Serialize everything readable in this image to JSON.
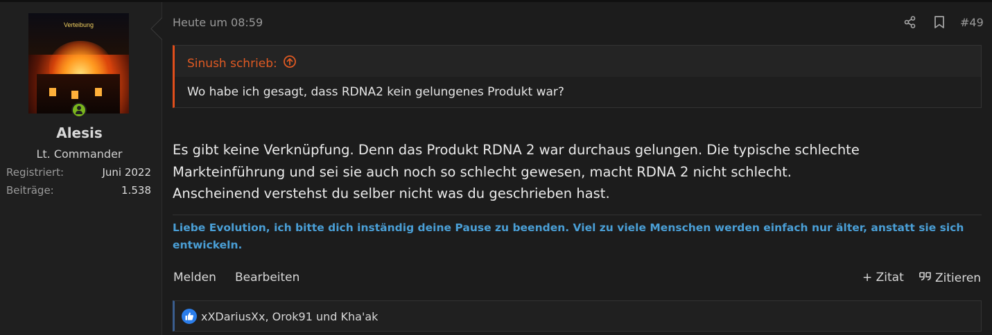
{
  "user": {
    "avatar_caption": "Verteibung",
    "name": "Alesis",
    "title": "Lt. Commander",
    "stats": [
      {
        "label": "Registriert:",
        "value": "Juni 2022"
      },
      {
        "label": "Beiträge:",
        "value": "1.538"
      }
    ],
    "online_status_icon": "user-online-icon"
  },
  "post": {
    "date": "Heute um 08:59",
    "number": "#49",
    "icons": {
      "share": "share-icon",
      "bookmark": "bookmark-icon"
    },
    "quote": {
      "author_label": "Sinush schrieb:",
      "text": "Wo habe ich gesagt, dass RDNA2 kein gelungenes Produkt war?"
    },
    "message_lines": [
      "Es gibt keine Verknüpfung. Denn das Produkt RDNA 2 war durchaus gelungen. Die typische schlechte",
      "Markteinführung und sei sie auch noch so schlecht gewesen, macht RDNA 2 nicht schlecht.",
      "Anscheinend verstehst du selber nicht was du geschrieben hast."
    ],
    "signature": "Liebe Evolution, ich bitte dich inständig deine Pause zu beenden. Viel zu viele Menschen werden einfach nur älter, anstatt sie sich entwickeln.",
    "actions": {
      "report": "Melden",
      "edit": "Bearbeiten",
      "add_quote": "+ Zitat",
      "reply_quote": "Zitieren"
    },
    "reactions": "xXDariusXx, Orok91 und Kha'ak"
  },
  "colors": {
    "background": "#1c1c1c",
    "quote_accent": "#e04e1b",
    "signature": "#4a9fd6",
    "online": "#7ab51d",
    "like": "#2b7de9"
  }
}
